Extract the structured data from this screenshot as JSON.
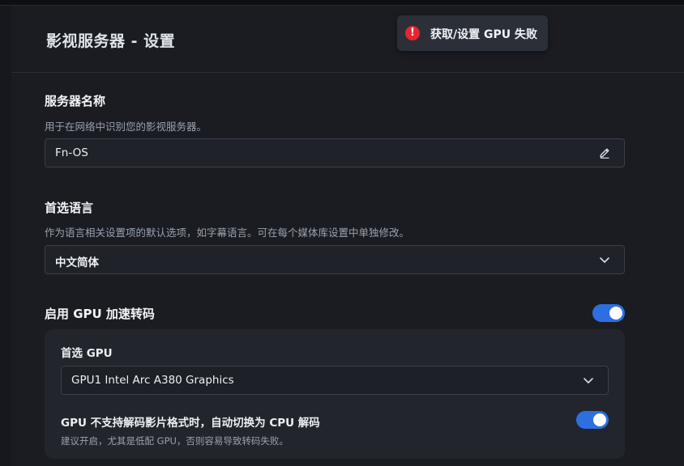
{
  "page": {
    "title": "影视服务器 - 设置"
  },
  "toast": {
    "icon": "error-icon",
    "icon_glyph": "!",
    "message": "获取/设置 GPU 失败",
    "color": "#e5252f"
  },
  "server_name": {
    "title": "服务器名称",
    "description": "用于在网络中识别您的影视服务器。",
    "value": "Fn-OS",
    "icon": "edit-pencil-icon"
  },
  "language": {
    "title": "首选语言",
    "description": "作为语言相关设置项的默认选项，如字幕语言。可在每个媒体库设置中单独修改。",
    "selected": "中文简体",
    "icon": "chevron-down-icon"
  },
  "gpu": {
    "title": "启用 GPU 加速转码",
    "enabled": true,
    "accent": "#2d6fe0",
    "preferred_label": "首选 GPU",
    "preferred_selected": "GPU1 Intel Arc A380 Graphics",
    "fallback_label": "GPU 不支持解码影片格式时，自动切换为 CPU 解码",
    "fallback_hint": "建议开启，尤其是低配 GPU，否则容易导致转码失败。",
    "fallback_enabled": true
  }
}
